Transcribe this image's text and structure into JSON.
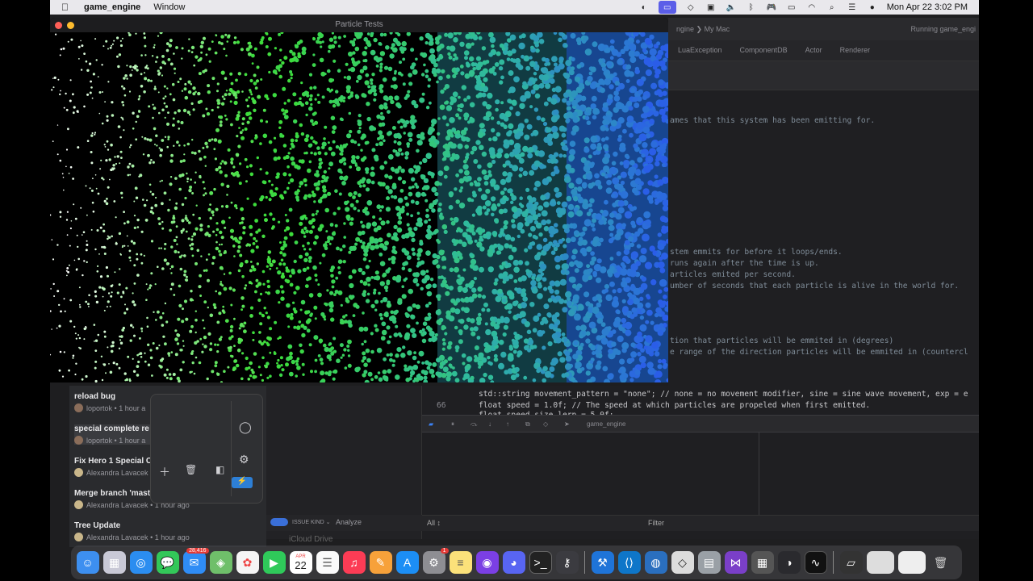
{
  "menubar": {
    "app_name": "game_engine",
    "menus": [
      "Window"
    ],
    "clock": "Mon Apr 22  3:02 PM"
  },
  "particle_window": {
    "title": "Particle Tests"
  },
  "xcode": {
    "breadcrumb": "ngine ❯  My Mac",
    "running": "Running game_engi",
    "tabs": [
      "LuaException",
      "ComponentDB",
      "Actor",
      "Renderer"
    ],
    "code_lines": [
      "ames that this system has been emitting for.",
      "stem emmits for before it loops/ends.",
      " runs again after the time is up.",
      "articles emited per second.",
      "umber of seconds that each particle is alive in the world for.",
      "tion that particles will be emmited in (degrees)",
      "e range of the direction particles will be emmited in (countercl"
    ],
    "lower_code": [
      {
        "ln": "",
        "text": "std::string movement_pattern = \"none\"; // none = no movement modifier, sine = sine wave movement, exp = e"
      },
      {
        "ln": "66",
        "text": "float speed = 1.0f; // The speed at which particles are propeled when first emitted."
      },
      {
        "ln": "",
        "text": "float speed_size_lerp = 5.0f;"
      }
    ],
    "debug_target": "game_engine",
    "filter_all": "All ↕",
    "filter_placeholder": "Filter",
    "issue_kind": "ISSUE KIND ⌄",
    "analyze": "Analyze",
    "icloud": "iCloud Drive"
  },
  "git_panel": {
    "commits": [
      {
        "title": "reload bug",
        "author": "loportok",
        "time": "1 hour a"
      },
      {
        "title": "special complete re",
        "author": "loportok",
        "time": "1 hour a"
      },
      {
        "title": "Fix Hero 1 Special C",
        "author": "Alexandra Lavacek",
        "time": ""
      },
      {
        "title": "Merge branch 'mast",
        "author": "Alexandra Lavacek",
        "time": "1 hour ago"
      },
      {
        "title": "Tree Update",
        "author": "Alexandra Lavacek",
        "time": "1 hour ago"
      }
    ]
  },
  "dock": {
    "calendar_month": "APR",
    "calendar_day": "22",
    "mail_badge": "28,416",
    "notif_badge": "1",
    "icons": [
      "finder-icon",
      "launchpad-icon",
      "safari-icon",
      "messages-icon",
      "mail-icon",
      "maps-icon",
      "photos-icon",
      "facetime-icon",
      "calendar-icon",
      "reminders-icon",
      "music-icon",
      "pages-icon",
      "app-store-icon",
      "system-settings-icon",
      "notes-icon",
      "github-icon",
      "discord-icon",
      "terminal-icon",
      "keychain-icon",
      "xcode-icon",
      "vscode-icon",
      "sourcetree-icon",
      "unity-icon",
      "disk-utility-icon",
      "visual-studio-icon",
      "calculator-icon",
      "steam-icon",
      "activity-monitor-icon"
    ]
  },
  "colors": {
    "particle_white": "#ffffff",
    "particle_green": "#3ddc3a",
    "particle_teal": "#2fb9a0",
    "particle_blue": "#2a5de8",
    "menubar_bg": "#e9e8ec"
  }
}
